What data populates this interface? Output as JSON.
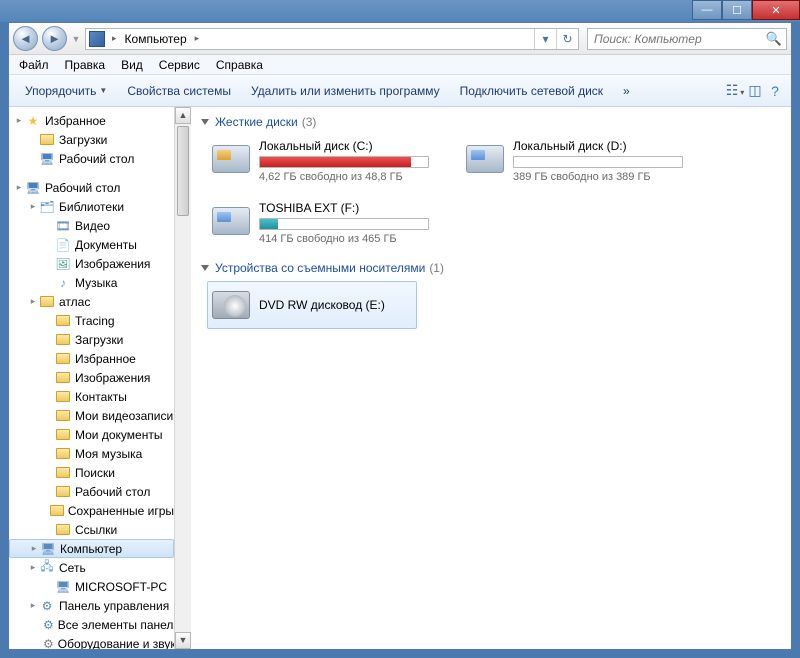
{
  "window_controls": {
    "min": "—",
    "max": "☐",
    "close": "✕"
  },
  "address": {
    "root": "Компьютер",
    "chevron": "▸"
  },
  "search": {
    "placeholder": "Поиск: Компьютер"
  },
  "menubar": [
    "Файл",
    "Правка",
    "Вид",
    "Сервис",
    "Справка"
  ],
  "toolbar": {
    "organize": "Упорядочить",
    "system_props": "Свойства системы",
    "uninstall": "Удалить или изменить программу",
    "map_drive": "Подключить сетевой диск",
    "more": "»"
  },
  "nav": {
    "favorites": "Избранное",
    "downloads": "Загрузки",
    "desktop_fav": "Рабочий стол",
    "desktop": "Рабочий стол",
    "libraries": "Библиотеки",
    "videos": "Видео",
    "documents": "Документы",
    "pictures": "Изображения",
    "music": "Музыка",
    "atlas": "атлас",
    "tracing": "Tracing",
    "downloads2": "Загрузки",
    "favorites2": "Избранное",
    "pictures2": "Изображения",
    "contacts": "Контакты",
    "myvideo": "Мои видеозаписи",
    "mydocs": "Мои документы",
    "mymusic": "Моя музыка",
    "searches": "Поиски",
    "desktop2": "Рабочий стол",
    "savedgames": "Сохраненные игры",
    "links": "Ссылки",
    "computer": "Компьютер",
    "network": "Сеть",
    "microsoft_pc": "MICROSOFT-PC",
    "control_panel": "Панель управления",
    "all_cp": "Все элементы панели",
    "hardware": "Оборудование и звук"
  },
  "content": {
    "cat_hdd": "Жесткие диски",
    "cat_hdd_count": "(3)",
    "cat_removable": "Устройства со съемными носителями",
    "cat_removable_count": "(1)",
    "drives": [
      {
        "name": "Локальный диск (C:)",
        "sub": "4,62 ГБ свободно из 48,8 ГБ",
        "fill": 90,
        "fill_class": "red",
        "icon": "sys"
      },
      {
        "name": "Локальный диск (D:)",
        "sub": "389 ГБ свободно из 389 ГБ",
        "fill": 1,
        "fill_class": "",
        "icon": ""
      },
      {
        "name": "TOSHIBA EXT (F:)",
        "sub": "414 ГБ свободно из 465 ГБ",
        "fill": 11,
        "fill_class": "teal",
        "icon": ""
      }
    ],
    "dvd": {
      "name": "DVD RW дисковод (E:)"
    }
  }
}
